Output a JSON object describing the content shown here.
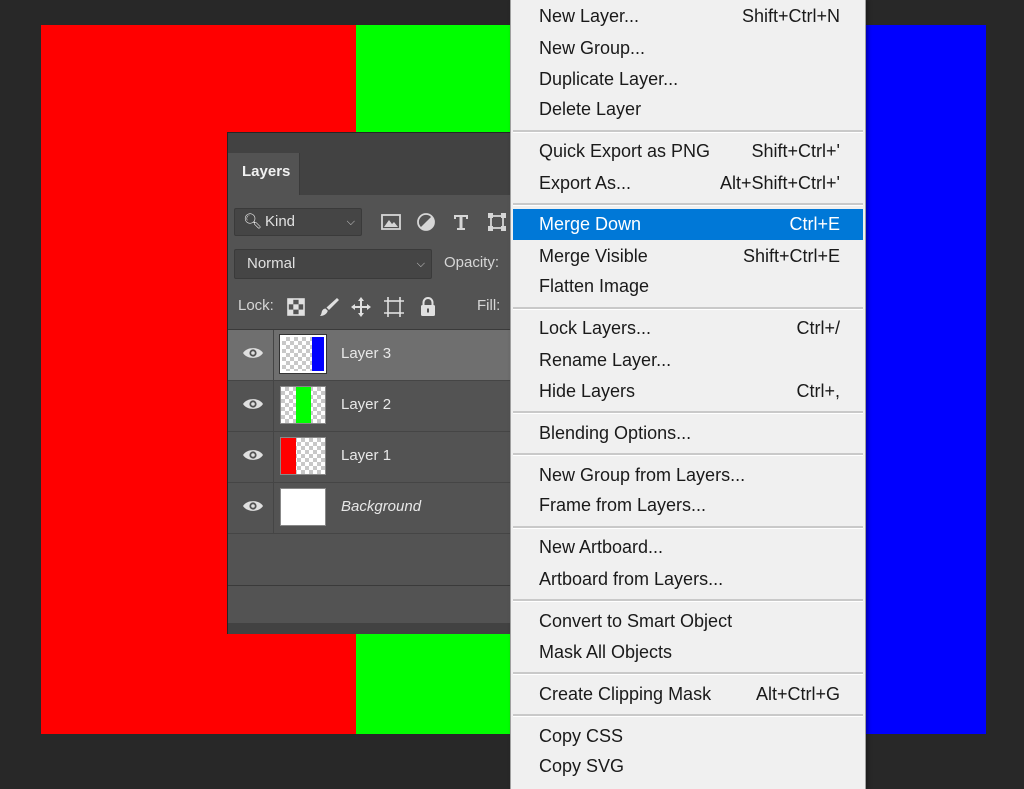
{
  "canvas": {
    "colors": {
      "red": "#ff0000",
      "green": "#00ff00",
      "blue": "#0000ff",
      "background": "#282828"
    }
  },
  "layers_panel": {
    "tab_label": "Layers",
    "filter": {
      "kind_label": "Kind"
    },
    "blend_mode": "Normal",
    "opacity_label": "Opacity:",
    "lock_label": "Lock:",
    "fill_label": "Fill:",
    "layers": [
      {
        "name": "Layer 3",
        "selected": true,
        "visible": true,
        "thumb_color": "#0000ff"
      },
      {
        "name": "Layer 2",
        "selected": false,
        "visible": true,
        "thumb_color": "#00ff00"
      },
      {
        "name": "Layer 1",
        "selected": false,
        "visible": true,
        "thumb_color": "#ff0000"
      },
      {
        "name": "Background",
        "selected": false,
        "visible": true,
        "thumb_color": "#ffffff"
      }
    ]
  },
  "context_menu": {
    "highlight_color": "#0078d7",
    "items": [
      {
        "label": "New Layer...",
        "shortcut": "Shift+Ctrl+N"
      },
      {
        "label": "New Group...",
        "shortcut": ""
      },
      {
        "label": "Duplicate Layer...",
        "shortcut": ""
      },
      {
        "label": "Delete Layer",
        "shortcut": ""
      },
      {
        "label": "Quick Export as PNG",
        "shortcut": "Shift+Ctrl+'"
      },
      {
        "label": "Export As...",
        "shortcut": "Alt+Shift+Ctrl+'"
      },
      {
        "label": "Merge Down",
        "shortcut": "Ctrl+E",
        "highlighted": true
      },
      {
        "label": "Merge Visible",
        "shortcut": "Shift+Ctrl+E"
      },
      {
        "label": "Flatten Image",
        "shortcut": ""
      },
      {
        "label": "Lock Layers...",
        "shortcut": "Ctrl+/"
      },
      {
        "label": "Rename Layer...",
        "shortcut": ""
      },
      {
        "label": "Hide Layers",
        "shortcut": "Ctrl+,"
      },
      {
        "label": "Blending Options...",
        "shortcut": ""
      },
      {
        "label": "New Group from Layers...",
        "shortcut": ""
      },
      {
        "label": "Frame from Layers...",
        "shortcut": ""
      },
      {
        "label": "New Artboard...",
        "shortcut": ""
      },
      {
        "label": "Artboard from Layers...",
        "shortcut": ""
      },
      {
        "label": "Convert to Smart Object",
        "shortcut": ""
      },
      {
        "label": "Mask All Objects",
        "shortcut": ""
      },
      {
        "label": "Create Clipping Mask",
        "shortcut": "Alt+Ctrl+G"
      },
      {
        "label": "Copy CSS",
        "shortcut": ""
      },
      {
        "label": "Copy SVG",
        "shortcut": ""
      }
    ]
  }
}
